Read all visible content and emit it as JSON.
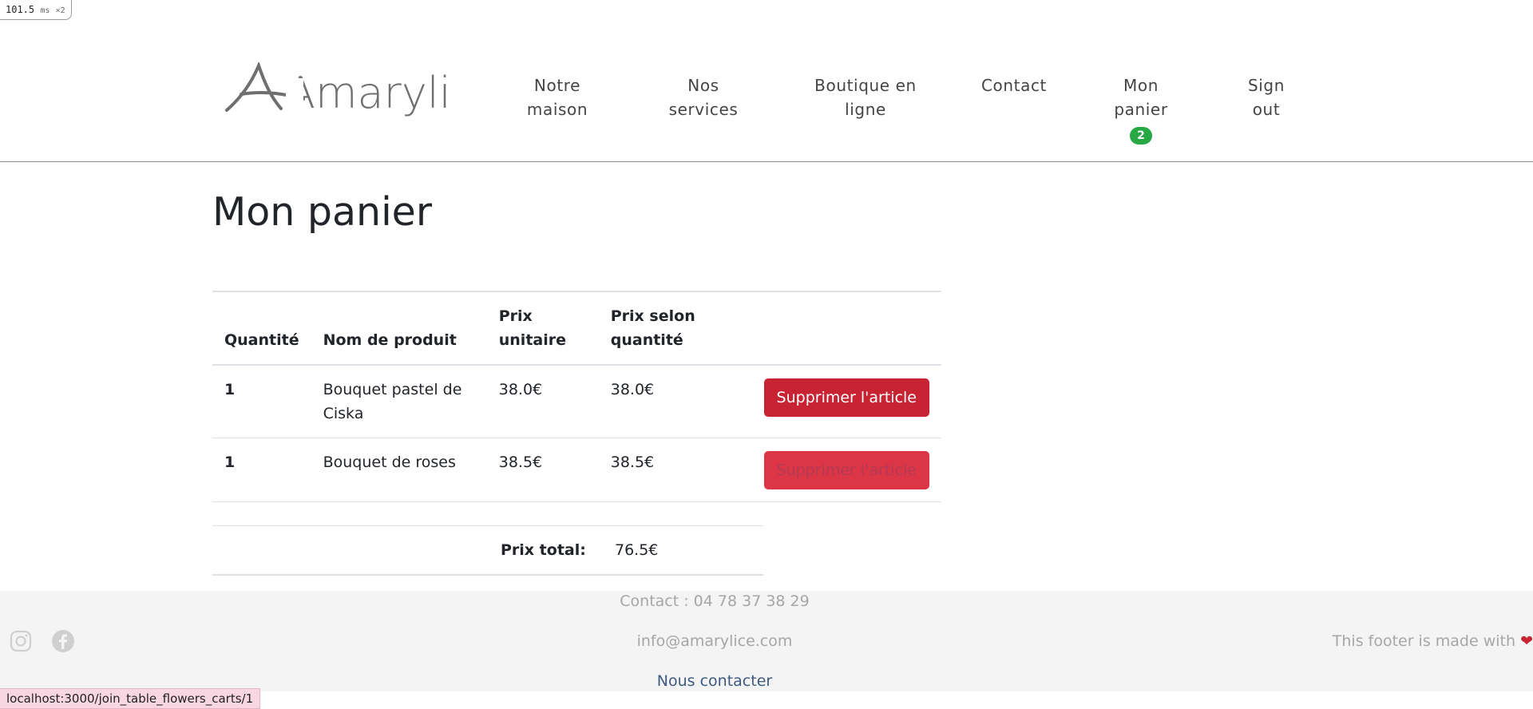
{
  "perf_badge": {
    "value": "101.5",
    "unit": "ms",
    "multiplier": "×2"
  },
  "header": {
    "logo_text": "Amarylice",
    "nav": [
      {
        "lines": [
          "Notre",
          "maison"
        ]
      },
      {
        "lines": [
          "Nos",
          "services"
        ]
      },
      {
        "lines": [
          "Boutique en",
          "ligne"
        ]
      },
      {
        "lines": [
          "Contact"
        ]
      },
      {
        "lines": [
          "Mon",
          "panier"
        ],
        "badge": "2"
      },
      {
        "lines": [
          "Sign",
          "out"
        ]
      }
    ]
  },
  "main": {
    "title": "Mon panier",
    "table": {
      "headers": {
        "qty": "Quantité",
        "name": "Nom de produit",
        "unit_price": [
          "Prix",
          "unitaire"
        ],
        "subtotal": [
          "Prix selon",
          "quantité"
        ]
      },
      "rows": [
        {
          "qty": "1",
          "name": [
            "Bouquet pastel de",
            "Ciska"
          ],
          "unit_price": "38.0€",
          "subtotal": "38.0€",
          "action": "Supprimer l'article"
        },
        {
          "qty": "1",
          "name": [
            "Bouquet de roses"
          ],
          "unit_price": "38.5€",
          "subtotal": "38.5€",
          "action": "Supprimer l'article"
        }
      ]
    },
    "total": {
      "label": "Prix total:",
      "value": "76.5€"
    }
  },
  "footer": {
    "phone": "Contact : 04 78 37 38 29",
    "email": "info@amarylice.com",
    "contact_link": "Nous contacter",
    "made_with": "This footer is made with",
    "heart": "❤"
  },
  "status_bar": {
    "url": "localhost:3000/join_table_flowers_carts/1"
  },
  "colors": {
    "danger": "#c82333",
    "danger_hover": "#dc3545",
    "badge_success": "#28a745",
    "footer_bg": "#f4f4f4",
    "link": "#3d5a80"
  }
}
